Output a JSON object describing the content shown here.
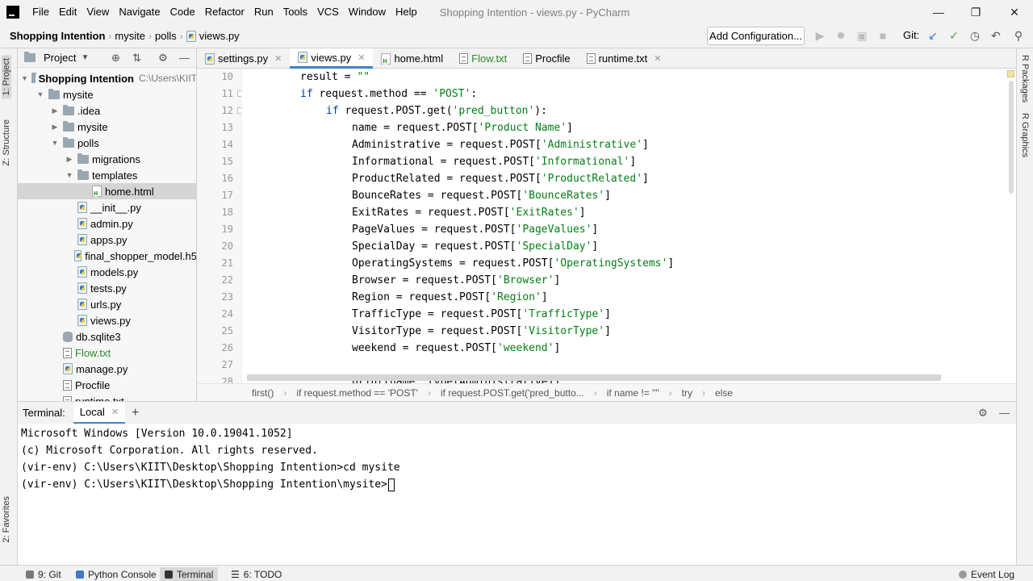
{
  "menubar": {
    "items": [
      "File",
      "Edit",
      "View",
      "Navigate",
      "Code",
      "Refactor",
      "Run",
      "Tools",
      "VCS",
      "Window",
      "Help"
    ],
    "title": "Shopping Intention - views.py - PyCharm"
  },
  "navbar": {
    "crumbs": [
      "Shopping Intention",
      "mysite",
      "polls",
      "views.py"
    ],
    "add_config": "Add Configuration...",
    "git_label": "Git:"
  },
  "left_stripe": {
    "project_tab": "1: Project",
    "structure_tab": "Z: Structure",
    "favorites_tab": "2: Favorites"
  },
  "right_stripe": {
    "packages_tab": "R Packages",
    "graphics_tab": "R Graphics"
  },
  "project": {
    "header": "Project",
    "root_name": "Shopping Intention",
    "root_path": "C:\\Users\\KIIT",
    "tree": [
      {
        "label": "mysite",
        "kind": "folder",
        "level": 1,
        "arrow": "down"
      },
      {
        "label": ".idea",
        "kind": "folder",
        "level": 2,
        "arrow": "right"
      },
      {
        "label": "mysite",
        "kind": "folder",
        "level": 2,
        "arrow": "right"
      },
      {
        "label": "polls",
        "kind": "folder",
        "level": 2,
        "arrow": "down"
      },
      {
        "label": "migrations",
        "kind": "folder",
        "level": 3,
        "arrow": "right"
      },
      {
        "label": "templates",
        "kind": "folder",
        "level": 3,
        "arrow": "down"
      },
      {
        "label": "home.html",
        "kind": "html",
        "level": 4,
        "arrow": "",
        "selected": true
      },
      {
        "label": "__init__.py",
        "kind": "py",
        "level": 3,
        "arrow": ""
      },
      {
        "label": "admin.py",
        "kind": "py",
        "level": 3,
        "arrow": ""
      },
      {
        "label": "apps.py",
        "kind": "py",
        "level": 3,
        "arrow": ""
      },
      {
        "label": "final_shopper_model.h5",
        "kind": "py",
        "level": 3,
        "arrow": ""
      },
      {
        "label": "models.py",
        "kind": "py",
        "level": 3,
        "arrow": ""
      },
      {
        "label": "tests.py",
        "kind": "py",
        "level": 3,
        "arrow": ""
      },
      {
        "label": "urls.py",
        "kind": "py",
        "level": 3,
        "arrow": ""
      },
      {
        "label": "views.py",
        "kind": "py",
        "level": 3,
        "arrow": ""
      },
      {
        "label": "db.sqlite3",
        "kind": "db",
        "level": 2,
        "arrow": ""
      },
      {
        "label": "Flow.txt",
        "kind": "txt",
        "level": 2,
        "arrow": "",
        "green": true
      },
      {
        "label": "manage.py",
        "kind": "py",
        "level": 2,
        "arrow": ""
      },
      {
        "label": "Procfile",
        "kind": "txt",
        "level": 2,
        "arrow": ""
      },
      {
        "label": "runtime.txt",
        "kind": "txt",
        "level": 2,
        "arrow": ""
      }
    ]
  },
  "tabs": [
    {
      "label": "settings.py",
      "kind": "py",
      "closable": true
    },
    {
      "label": "views.py",
      "kind": "py",
      "closable": true,
      "active": true
    },
    {
      "label": "home.html",
      "kind": "html",
      "closable": false
    },
    {
      "label": "Flow.txt",
      "kind": "txt",
      "closable": false,
      "green": true
    },
    {
      "label": "Procfile",
      "kind": "txt",
      "closable": false
    },
    {
      "label": "runtime.txt",
      "kind": "txt",
      "closable": true
    }
  ],
  "code": [
    {
      "n": "10",
      "indent": 1,
      "parts": [
        [
          "t",
          "result = "
        ],
        [
          "s",
          "\"\""
        ]
      ]
    },
    {
      "n": "11",
      "indent": 1,
      "parts": [
        [
          "k",
          "if "
        ],
        [
          "t",
          "request.method == "
        ],
        [
          "s",
          "'POST'"
        ],
        [
          "t",
          ":"
        ]
      ]
    },
    {
      "n": "12",
      "indent": 2,
      "parts": [
        [
          "k",
          "if "
        ],
        [
          "t",
          "request.POST.get("
        ],
        [
          "s",
          "'pred_button'"
        ],
        [
          "t",
          "):"
        ]
      ]
    },
    {
      "n": "13",
      "indent": 3,
      "parts": [
        [
          "t",
          "name = request.POST["
        ],
        [
          "s",
          "'Product Name'"
        ],
        [
          "t",
          "]"
        ]
      ]
    },
    {
      "n": "14",
      "indent": 3,
      "parts": [
        [
          "t",
          "Administrative = request.POST["
        ],
        [
          "s",
          "'Administrative'"
        ],
        [
          "t",
          "]"
        ]
      ]
    },
    {
      "n": "15",
      "indent": 3,
      "parts": [
        [
          "t",
          "Informational = request.POST["
        ],
        [
          "s",
          "'Informational'"
        ],
        [
          "t",
          "]"
        ]
      ]
    },
    {
      "n": "16",
      "indent": 3,
      "parts": [
        [
          "t",
          "ProductRelated = request.POST["
        ],
        [
          "s",
          "'ProductRelated'"
        ],
        [
          "t",
          "]"
        ]
      ]
    },
    {
      "n": "17",
      "indent": 3,
      "parts": [
        [
          "t",
          "BounceRates = request.POST["
        ],
        [
          "s",
          "'BounceRates'"
        ],
        [
          "t",
          "]"
        ]
      ]
    },
    {
      "n": "18",
      "indent": 3,
      "parts": [
        [
          "t",
          "ExitRates = request.POST["
        ],
        [
          "s",
          "'ExitRates'"
        ],
        [
          "t",
          "]"
        ]
      ]
    },
    {
      "n": "19",
      "indent": 3,
      "parts": [
        [
          "t",
          "PageValues = request.POST["
        ],
        [
          "s",
          "'PageValues'"
        ],
        [
          "t",
          "]"
        ]
      ]
    },
    {
      "n": "20",
      "indent": 3,
      "parts": [
        [
          "t",
          "SpecialDay = request.POST["
        ],
        [
          "s",
          "'SpecialDay'"
        ],
        [
          "t",
          "]"
        ]
      ]
    },
    {
      "n": "21",
      "indent": 3,
      "parts": [
        [
          "t",
          "OperatingSystems = request.POST["
        ],
        [
          "s",
          "'OperatingSystems'"
        ],
        [
          "t",
          "]"
        ]
      ]
    },
    {
      "n": "22",
      "indent": 3,
      "parts": [
        [
          "t",
          "Browser = request.POST["
        ],
        [
          "s",
          "'Browser'"
        ],
        [
          "t",
          "]"
        ]
      ]
    },
    {
      "n": "23",
      "indent": 3,
      "parts": [
        [
          "t",
          "Region = request.POST["
        ],
        [
          "s",
          "'Region'"
        ],
        [
          "t",
          "]"
        ]
      ]
    },
    {
      "n": "24",
      "indent": 3,
      "parts": [
        [
          "t",
          "TrafficType = request.POST["
        ],
        [
          "s",
          "'TrafficType'"
        ],
        [
          "t",
          "]"
        ]
      ]
    },
    {
      "n": "25",
      "indent": 3,
      "parts": [
        [
          "t",
          "VisitorType = request.POST["
        ],
        [
          "s",
          "'VisitorType'"
        ],
        [
          "t",
          "]"
        ]
      ]
    },
    {
      "n": "26",
      "indent": 3,
      "parts": [
        [
          "t",
          "weekend = request.POST["
        ],
        [
          "s",
          "'weekend'"
        ],
        [
          "t",
          "]"
        ]
      ]
    },
    {
      "n": "27",
      "indent": 0,
      "parts": []
    },
    {
      "n": "28",
      "indent": 3,
      "parts": [
        [
          "t",
          "print(name, type(Administrative))"
        ]
      ]
    }
  ],
  "structure_bar": [
    "first()",
    "if request.method == 'POST'",
    "if request.POST.get('pred_butto...",
    "if name != \"\"",
    "try",
    "else"
  ],
  "terminal": {
    "label": "Terminal:",
    "tab": "Local",
    "plus": "+",
    "lines": [
      "Microsoft Windows [Version 10.0.19041.1052]",
      "(c) Microsoft Corporation. All rights reserved.",
      "(vir-env) C:\\Users\\KIIT\\Desktop\\Shopping Intention>cd mysite",
      "(vir-env) C:\\Users\\KIIT\\Desktop\\Shopping Intention\\mysite>"
    ]
  },
  "bottom_bar": {
    "git": "9: Git",
    "python_console": "Python Console",
    "terminal": "Terminal",
    "todo": "6: TODO",
    "event_log": "Event Log"
  },
  "colors": {
    "accent": "#4083c9",
    "keyword": "#0033b3",
    "string": "#067d17",
    "green_file": "#2a8a2a"
  }
}
